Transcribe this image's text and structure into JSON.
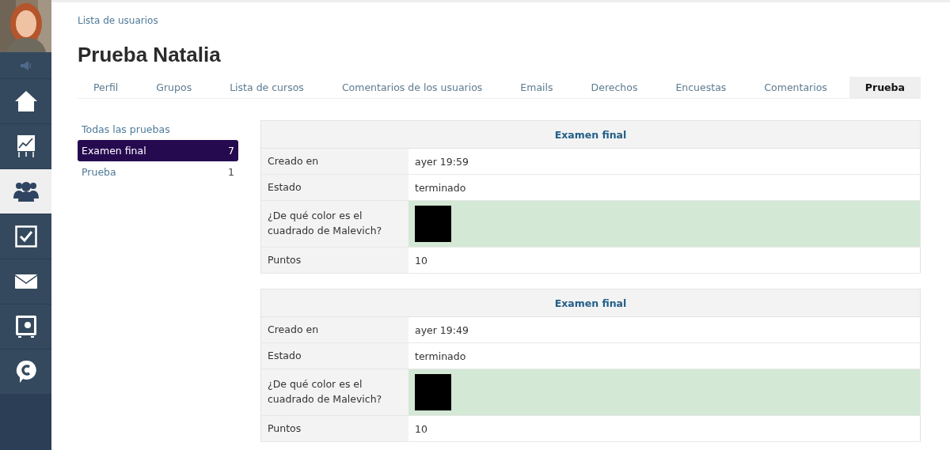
{
  "sidebar": {
    "items": [
      {
        "kind": "speaker",
        "selected": false
      },
      {
        "kind": "home",
        "selected": false
      },
      {
        "kind": "chart",
        "selected": false
      },
      {
        "kind": "users",
        "selected": true
      },
      {
        "kind": "check",
        "selected": false
      },
      {
        "kind": "mail",
        "selected": false
      },
      {
        "kind": "safe",
        "selected": false
      },
      {
        "kind": "chat",
        "selected": false
      }
    ]
  },
  "breadcrumb": "Lista de usuarios",
  "title": "Prueba Natalia",
  "tabs": [
    {
      "label": "Perfil",
      "selected": false
    },
    {
      "label": "Grupos",
      "selected": false
    },
    {
      "label": "Lista de cursos",
      "selected": false
    },
    {
      "label": "Comentarios de los usuarios",
      "selected": false
    },
    {
      "label": "Emails",
      "selected": false
    },
    {
      "label": "Derechos",
      "selected": false
    },
    {
      "label": "Encuestas",
      "selected": false
    },
    {
      "label": "Comentarios",
      "selected": false
    },
    {
      "label": "Prueba",
      "selected": true
    }
  ],
  "tests_nav": {
    "all_link": "Todas las pruebas",
    "items": [
      {
        "label": "Examen final",
        "count": "7",
        "selected": true
      },
      {
        "label": "Prueba",
        "count": "1",
        "selected": false
      }
    ]
  },
  "results": [
    {
      "title": "Examen final",
      "rows": [
        {
          "kind": "text",
          "label": "Creado en",
          "value": "ayer 19:59"
        },
        {
          "kind": "text",
          "label": "Estado",
          "value": "terminado"
        },
        {
          "label": "¿De qué color es el cuadrado de Malevich?",
          "correct": true
        },
        {
          "kind": "text",
          "label": "Puntos",
          "value": "10"
        }
      ]
    },
    {
      "title": "Examen final",
      "rows": [
        {
          "kind": "text",
          "label": "Creado en",
          "value": "ayer 19:49"
        },
        {
          "kind": "text",
          "label": "Estado",
          "value": "terminado"
        },
        {
          "label": "¿De qué color es el cuadrado de Malevich?",
          "correct": true
        },
        {
          "kind": "text",
          "label": "Puntos",
          "value": "10"
        }
      ]
    }
  ]
}
